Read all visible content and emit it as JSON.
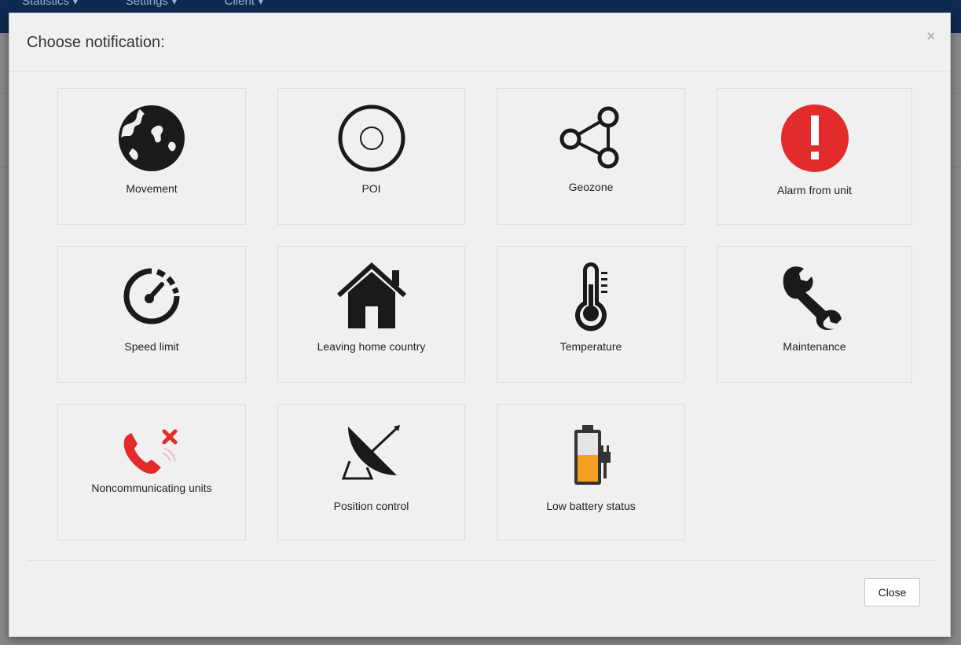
{
  "app_nav": [
    "Statistics ▾",
    "Settings ▾",
    "Client ▾"
  ],
  "modal": {
    "title": "Choose notification:",
    "close_x": "×",
    "close_button": "Close"
  },
  "tiles": [
    {
      "label": "Movement",
      "icon": "globe-icon"
    },
    {
      "label": "POI",
      "icon": "poi-icon"
    },
    {
      "label": "Geozone",
      "icon": "geozone-icon"
    },
    {
      "label": "Alarm from unit",
      "icon": "alarm-icon"
    },
    {
      "label": "Speed limit",
      "icon": "speedometer-icon"
    },
    {
      "label": "Leaving home country",
      "icon": "house-icon"
    },
    {
      "label": "Temperature",
      "icon": "thermometer-icon"
    },
    {
      "label": "Maintenance",
      "icon": "wrench-icon"
    },
    {
      "label": "Noncommunicating units",
      "icon": "phone-disconnected-icon"
    },
    {
      "label": "Position control",
      "icon": "satellite-dish-icon"
    },
    {
      "label": "Low battery status",
      "icon": "battery-charging-icon"
    }
  ],
  "colors": {
    "alarm": "#e32b2b",
    "phone": "#e32b2b",
    "battery": "#f5a020",
    "icon": "#1a1a1a"
  }
}
